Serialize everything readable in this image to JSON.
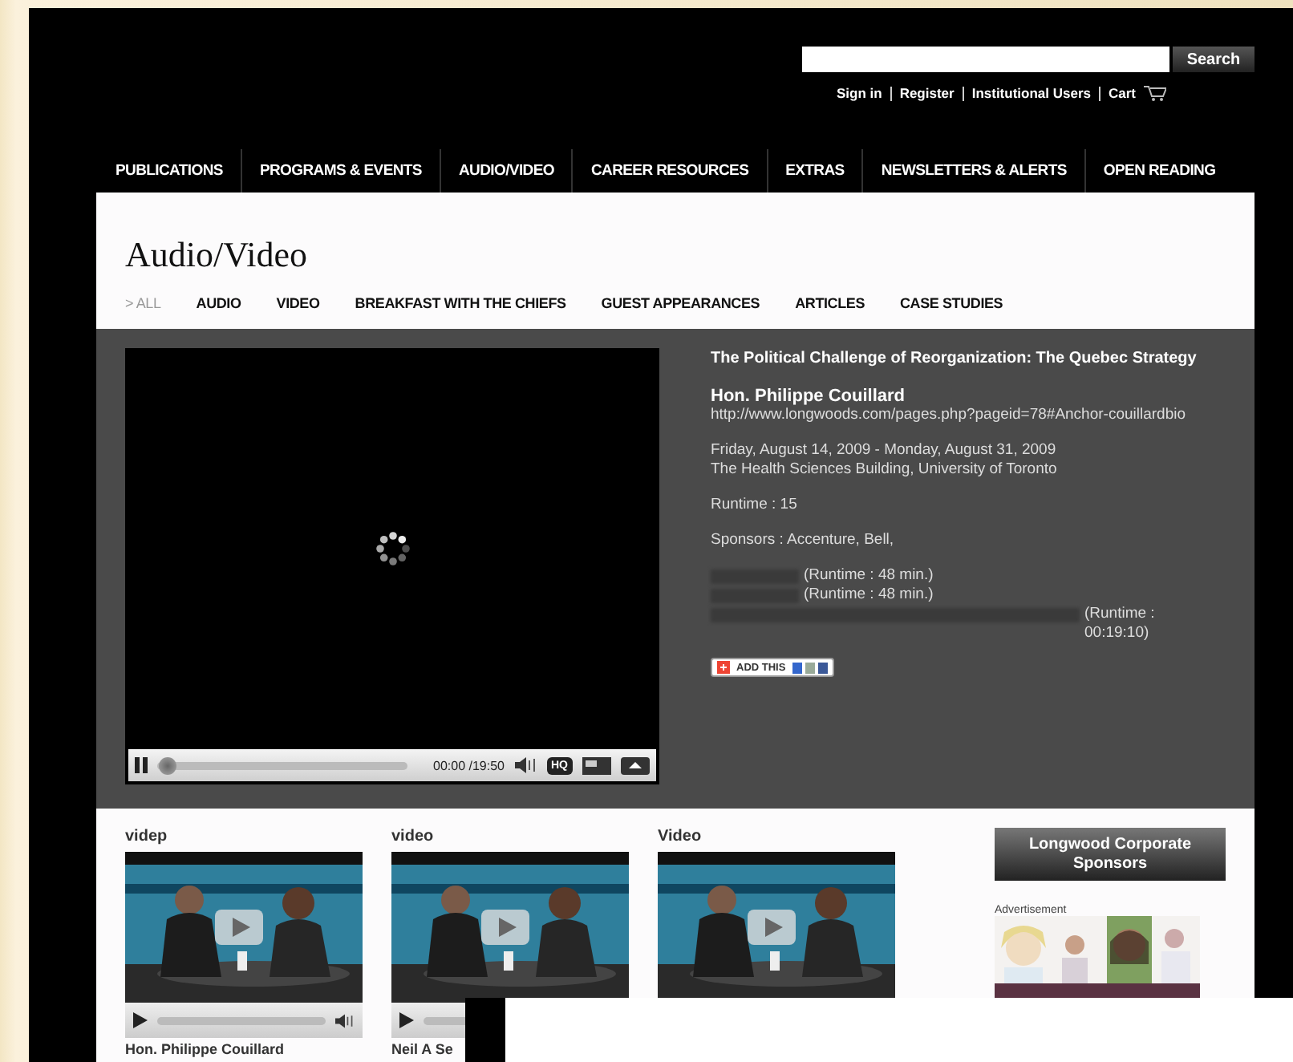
{
  "search": {
    "button": "Search"
  },
  "account_links": [
    {
      "label": "Sign in"
    },
    {
      "label": "Register"
    },
    {
      "label": "Institutional Users"
    },
    {
      "label": "Cart"
    }
  ],
  "nav": [
    {
      "label": "PUBLICATIONS"
    },
    {
      "label": "PROGRAMS & EVENTS"
    },
    {
      "label": "AUDIO/VIDEO"
    },
    {
      "label": "CAREER RESOURCES"
    },
    {
      "label": "EXTRAS"
    },
    {
      "label": "NEWSLETTERS & ALERTS"
    },
    {
      "label": "OPEN READING"
    }
  ],
  "page_title": "Audio/Video",
  "subnav": [
    {
      "label": "> ALL",
      "selected": true
    },
    {
      "label": "AUDIO",
      "selected": false
    },
    {
      "label": "VIDEO",
      "selected": false
    },
    {
      "label": "BREAKFAST WITH THE CHIEFS",
      "selected": false
    },
    {
      "label": "GUEST APPEARANCES",
      "selected": false
    },
    {
      "label": "ARTICLES",
      "selected": false
    },
    {
      "label": "CASE STUDIES",
      "selected": false
    }
  ],
  "player": {
    "playing": true,
    "level": 0.02,
    "time": "00:00 /19:50",
    "hq": "HQ"
  },
  "info": {
    "title": "The Political Challenge of Reorganization: The Quebec Strategy",
    "speaker": "Hon. Philippe Couillard",
    "url": "http://www.longwoods.com/pages.php?pageid=78#Anchor-couillardbio",
    "dates": "Friday, August 14, 2009 - Monday, August 31, 2009",
    "venue": "The Health Sciences Building, University of Toronto",
    "runtime": "Runtime : 15",
    "sponsors": "Sponsors : Accenture, Bell,",
    "items": [
      {
        "runtime": "(Runtime : 48 min.)",
        "kind": "short"
      },
      {
        "runtime": "(Runtime : 48 min.)",
        "kind": "short"
      },
      {
        "runtime": "(Runtime : 00:19:10)",
        "kind": "long"
      }
    ],
    "share": "ADD THIS"
  },
  "videos": [
    {
      "title": "videp",
      "caption": "Hon. Philippe Couillard",
      "kind": "full"
    },
    {
      "title": "video",
      "caption": "Neil A Se",
      "kind": "partial"
    },
    {
      "title": "Video",
      "kind": "bare"
    }
  ],
  "sidebar": {
    "sponsors_button": "Longwood Corporate Sponsors",
    "ad_label": "Advertisement"
  }
}
